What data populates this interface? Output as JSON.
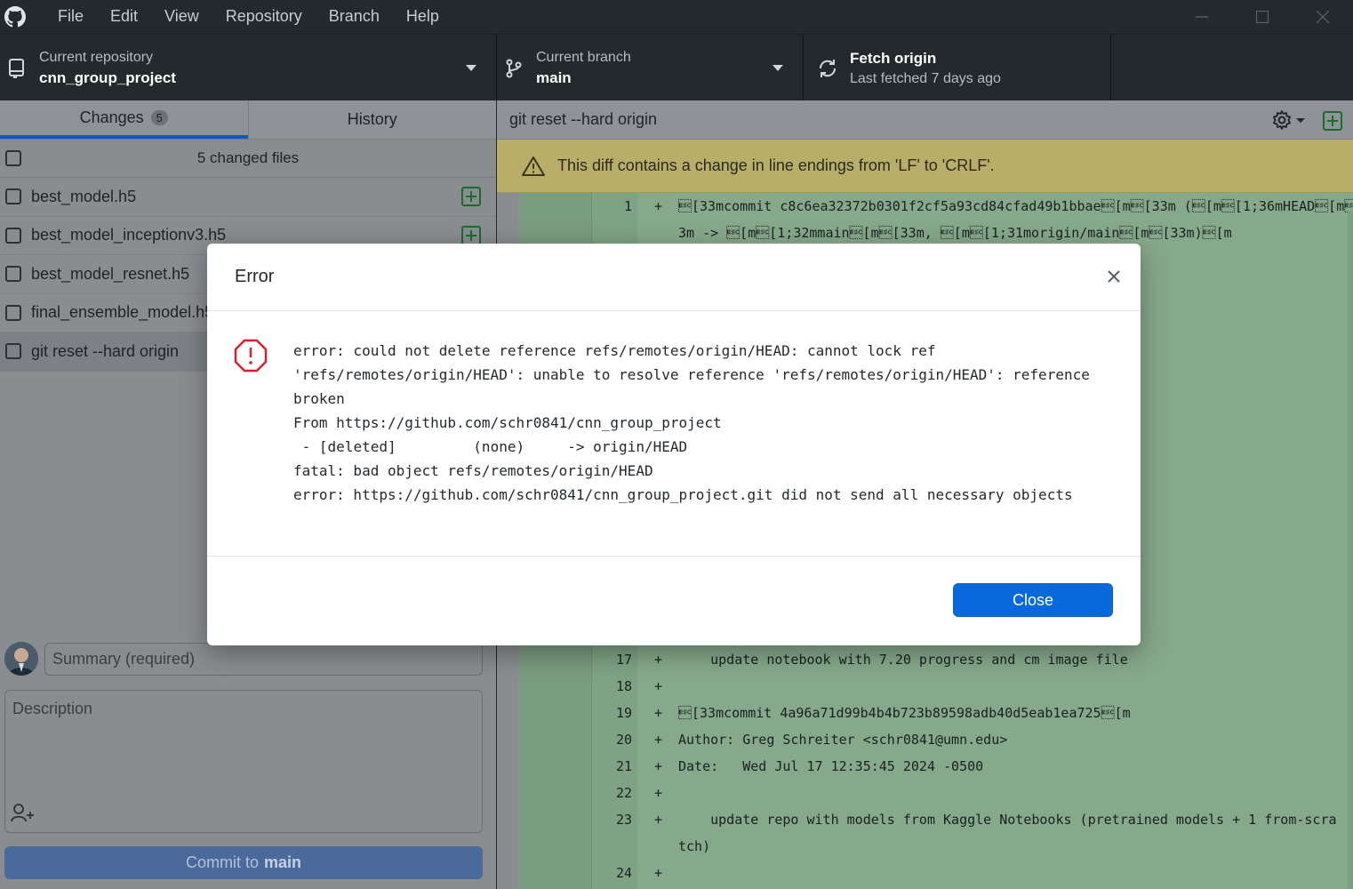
{
  "menu": [
    "File",
    "Edit",
    "View",
    "Repository",
    "Branch",
    "Help"
  ],
  "toolbar": {
    "repo_label": "Current repository",
    "repo_value": "cnn_group_project",
    "branch_label": "Current branch",
    "branch_value": "main",
    "fetch_label": "Fetch origin",
    "fetch_sub": "Last fetched 7 days ago"
  },
  "tabs": {
    "changes": "Changes",
    "changes_count": "5",
    "history": "History"
  },
  "files": {
    "header": "5 changed files",
    "items": [
      "best_model.h5",
      "best_model_inceptionv3.h5",
      "best_model_resnet.h5",
      "final_ensemble_model.h5",
      "git reset --hard origin"
    ]
  },
  "commit": {
    "summary_placeholder": "Summary (required)",
    "description_placeholder": "Description",
    "button_prefix": "Commit to",
    "button_branch": "main"
  },
  "diff": {
    "title": "git reset --hard origin",
    "warning": "This diff contains a change in line endings from 'LF' to 'CRLF'.",
    "lines": [
      {
        "num": "1",
        "sign": "+",
        "code": "\u001b[33mcommit c8c6ea32372b0301f2cf5a93cd84cfad49b1bbae\u001b[m\u001b[33m (\u001b[m\u001b[1;36mHEAD\u001b[m\u001b[3"
      },
      {
        "num": "",
        "sign": "",
        "code": "3m -> \u001b[m\u001b[1;32mmain\u001b[m\u001b[33m, \u001b[m\u001b[1;31morigin/main\u001b[m\u001b[33m)\u001b[m"
      },
      {
        "num": "17",
        "sign": "+",
        "code": "    update notebook with 7.20 progress and cm image file"
      },
      {
        "num": "18",
        "sign": "+",
        "code": ""
      },
      {
        "num": "19",
        "sign": "+",
        "code": "\u001b[33mcommit 4a96a71d99b4b4b723b89598adb40d5eab1ea725\u001b[m"
      },
      {
        "num": "20",
        "sign": "+",
        "code": "Author: Greg Schreiter <schr0841@umn.edu>"
      },
      {
        "num": "21",
        "sign": "+",
        "code": "Date:   Wed Jul 17 12:35:45 2024 -0500"
      },
      {
        "num": "22",
        "sign": "+",
        "code": ""
      },
      {
        "num": "23",
        "sign": "+",
        "code": "    update repo with models from Kaggle Notebooks (pretrained models + 1 from-scra"
      },
      {
        "num": "",
        "sign": "",
        "code": "tch)"
      },
      {
        "num": "24",
        "sign": "+",
        "code": ""
      }
    ]
  },
  "modal": {
    "title": "Error",
    "lines": [
      "error: could not delete reference refs/remotes/origin/HEAD: cannot lock ref",
      "'refs/remotes/origin/HEAD': unable to resolve reference 'refs/remotes/origin/HEAD': reference",
      "broken",
      "From https://github.com/schr0841/cnn_group_project",
      " - [deleted]         (none)     -> origin/HEAD",
      "fatal: bad object refs/remotes/origin/HEAD",
      "error: https://github.com/schr0841/cnn_group_project.git did not send all necessary objects"
    ],
    "close_label": "Close"
  }
}
